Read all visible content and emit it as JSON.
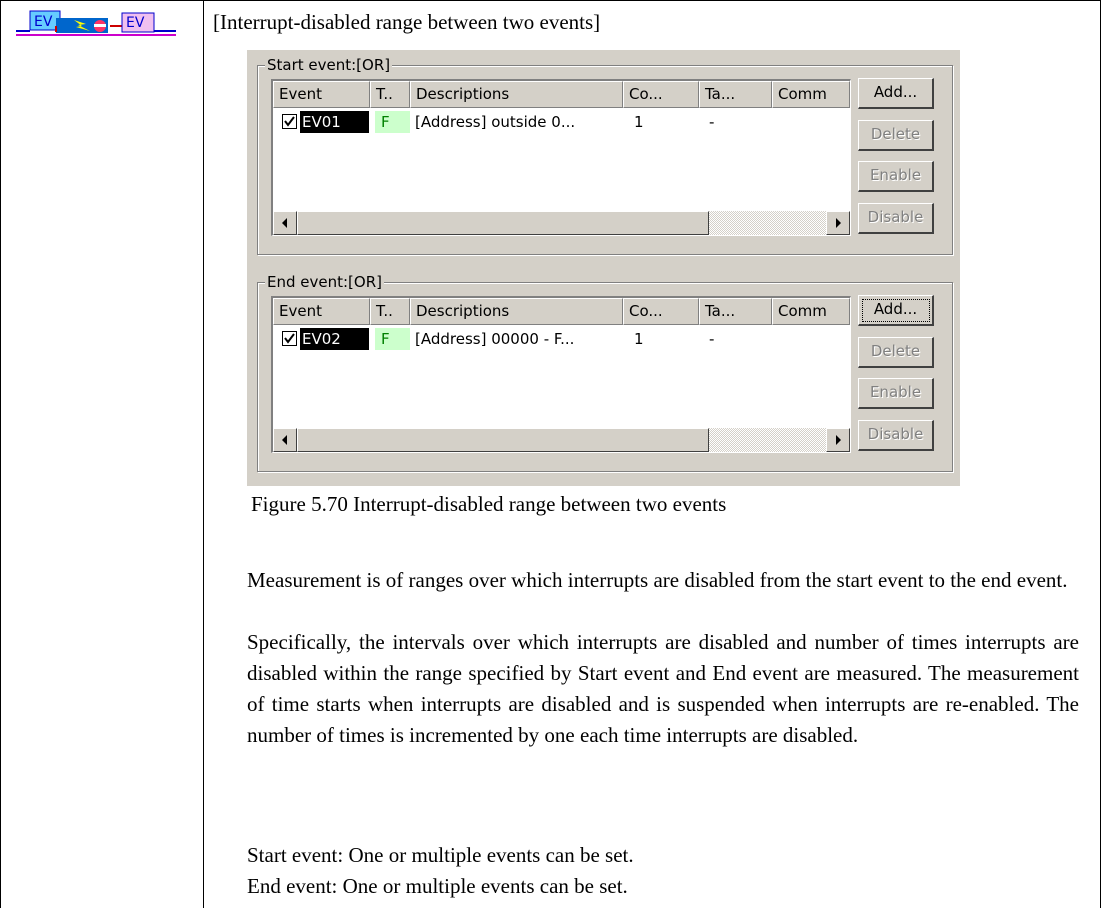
{
  "header_icon": {
    "left_label": "EV",
    "right_label": "EV",
    "icon": "interrupt-disabled-range-icon"
  },
  "heading": "[Interrupt-disabled range between two events]",
  "panel": {
    "columns": [
      "Event",
      "T..",
      "Descriptions",
      "Co...",
      "Ta...",
      "Comm"
    ],
    "groups": [
      {
        "legend": "Start event:[OR]",
        "row": {
          "checked": true,
          "event": "EV01",
          "type": "F",
          "description": "[Address] outside 0...",
          "count": "1",
          "target": "-"
        },
        "buttons": {
          "add": "Add...",
          "delete": "Delete",
          "enable": "Enable",
          "disable": "Disable"
        }
      },
      {
        "legend": "End event:[OR]",
        "row": {
          "checked": true,
          "event": "EV02",
          "type": "F",
          "description": "[Address] 00000 - F...",
          "count": "1",
          "target": "-"
        },
        "buttons": {
          "add": "Add...",
          "delete": "Delete",
          "enable": "Enable",
          "disable": "Disable"
        }
      }
    ],
    "colors": {
      "panel_bg": "#d4d0c8",
      "type_bg": "#ccffcc",
      "type_fg": "#008000"
    }
  },
  "caption": "Figure 5.70 Interrupt-disabled range between two events",
  "paragraphs": [
    "Measurement is of ranges over which interrupts are disabled from the start event to the end event.",
    "Specifically, the intervals over which interrupts are disabled and number of times interrupts are disabled within the range specified by Start event and End event are measured. The measurement of time starts when interrupts are disabled and is suspended when interrupts are re-enabled. The number of times is incremented by one each time interrupts are disabled."
  ],
  "notes": [
    "Start event: One or multiple events can be set.",
    "End event: One or multiple events can be set."
  ]
}
